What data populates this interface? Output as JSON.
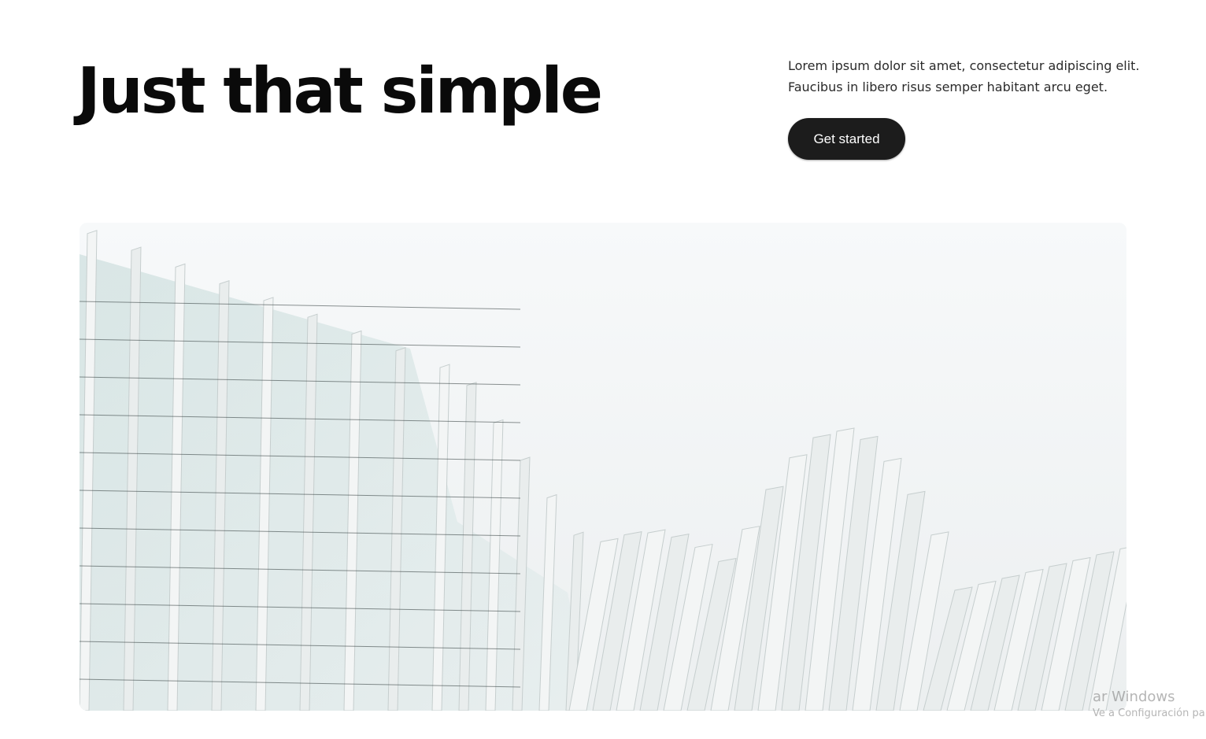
{
  "hero": {
    "title": "Just that simple",
    "description_line1": "Lorem ipsum dolor sit amet, consectetur adipiscing elit.",
    "description_line2": "Faucibus in libero risus semper habitant arcu eget.",
    "cta_label": "Get started"
  },
  "image": {
    "subject": "architecture-photo"
  },
  "os_watermark": {
    "line1": "ar Windows",
    "line2": "Ve a Configuración pa"
  },
  "colors": {
    "button_bg": "#1c1c1c",
    "button_text": "#ffffff",
    "heading": "#0a0a0a"
  }
}
